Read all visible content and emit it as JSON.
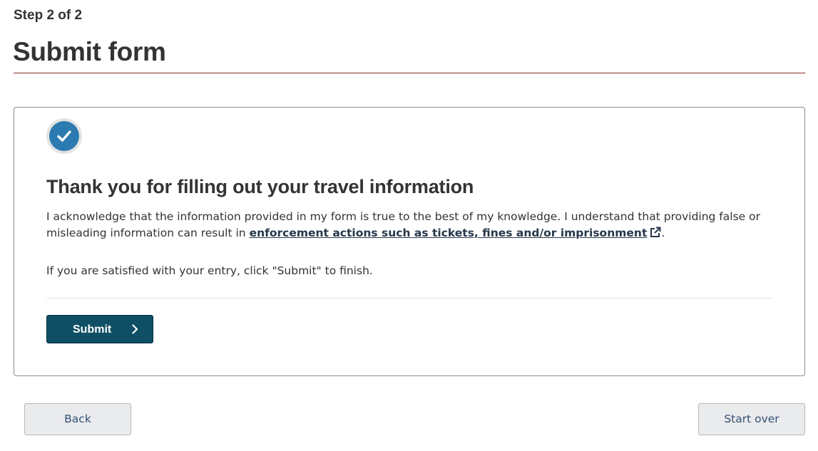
{
  "header": {
    "step": "Step 2 of 2",
    "title": "Submit form"
  },
  "card": {
    "status_icon": "check-circle-icon",
    "heading": "Thank you for filling out your travel information",
    "acknowledgement_before": "I acknowledge that the information provided in my form is true to the best of my knowledge. I understand that providing false or misleading information can result in ",
    "acknowledgement_link": "enforcement actions such as tickets, fines and/or imprisonment",
    "acknowledgement_link_icon": "external-link-icon",
    "acknowledgement_after": ".",
    "instruction": "If you are satisfied with your entry, click \"Submit\" to finish.",
    "submit_label": "Submit",
    "submit_icon": "chevron-right-icon"
  },
  "footer": {
    "back_label": "Back",
    "start_over_label": "Start over"
  },
  "colors": {
    "primary_button": "#0e4f66",
    "title_rule": "#8a2a2b",
    "check_circle": "#2b7ab0",
    "link": "#26374a",
    "secondary_button_bg": "#eaebed"
  }
}
